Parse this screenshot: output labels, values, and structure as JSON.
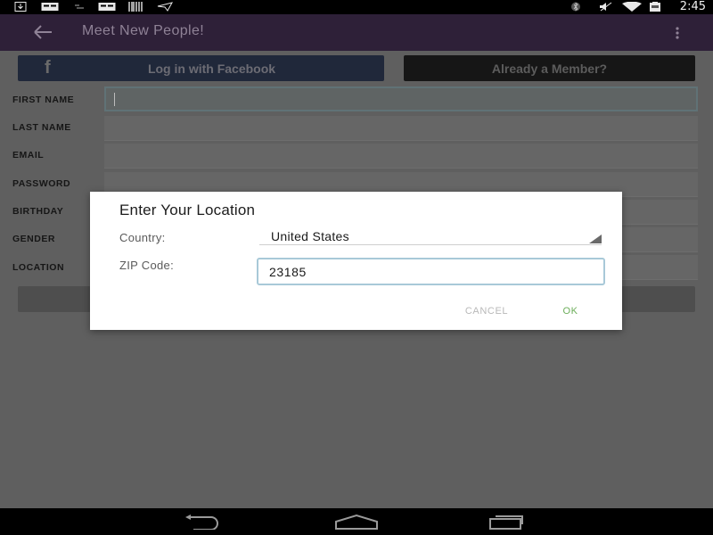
{
  "status_bar": {
    "time": "2:45",
    "left_icons": [
      "download-icon",
      "card-icon",
      "dots-icon",
      "card-icon",
      "barcode-icon",
      "send-icon"
    ],
    "right_icons": [
      "bluetooth-icon",
      "mute-icon",
      "wifi-icon",
      "battery-icon"
    ]
  },
  "app_bar": {
    "title": "Meet New People!",
    "back_icon": "arrow-left-icon",
    "menu_icon": "more-vert-icon"
  },
  "signup": {
    "facebook_button": "Log in with Facebook",
    "member_button": "Already a Member?",
    "fields": [
      {
        "label": "FIRST NAME",
        "value": ""
      },
      {
        "label": "LAST NAME",
        "value": ""
      },
      {
        "label": "EMAIL",
        "value": ""
      },
      {
        "label": "PASSWORD",
        "value": ""
      },
      {
        "label": "BIRTHDAY",
        "value": ""
      },
      {
        "label": "GENDER",
        "value": ""
      },
      {
        "label": "LOCATION",
        "value": ""
      }
    ]
  },
  "dialog": {
    "title": "Enter Your Location",
    "country_label": "Country:",
    "country_value": "United States",
    "zip_label": "ZIP Code:",
    "zip_value": "23185",
    "cancel": "CANCEL",
    "ok": "OK"
  },
  "colors": {
    "app_bar": "#2e2038",
    "dim_overlay": "#5f5f5f",
    "ok_accent": "#6cae5a",
    "zip_focus": "#a8c9d8"
  }
}
